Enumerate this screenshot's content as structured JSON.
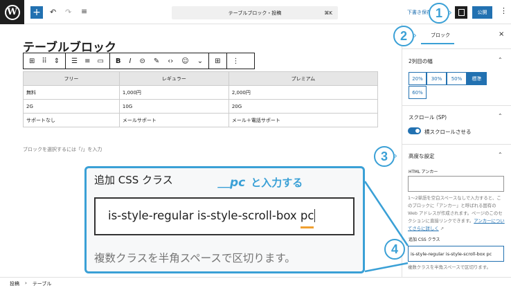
{
  "topbar": {
    "search": "テーブルブロック・投稿",
    "shortcut": "⌘K",
    "save_draft": "下書き保存",
    "publish": "公開"
  },
  "editor": {
    "title": "テーブルブロック",
    "placeholder": "ブロックを選択するには「/」を入力",
    "table": {
      "headers": [
        "フリー",
        "レギュラー",
        "プレミアム"
      ],
      "rows": [
        [
          "無料",
          "1,000円",
          "2,000円"
        ],
        [
          "2G",
          "10G",
          "20G"
        ],
        [
          "サポートなし",
          "メールサポート",
          "メール＋電話サポート"
        ]
      ]
    }
  },
  "sidebar": {
    "tab": "ブロック",
    "close": "×",
    "width_panel": {
      "title": "2列目の幅",
      "options": [
        "20%",
        "30%",
        "50%",
        "標準",
        "60%"
      ],
      "selected": "標準"
    },
    "scroll_panel": {
      "title": "スクロール (SP)",
      "toggle_label": "横スクロールさせる",
      "toggle_on": true
    },
    "advanced": {
      "title": "高度な設定",
      "anchor_label": "HTML アンカー",
      "anchor_value": "",
      "anchor_help": "1〜2単語を空白スペースなしで入力すると、このブロックに「アンカー」と呼ばれる固有の Web アドレスが作成されます。ページのこのセクションに直接リンクできます。",
      "anchor_link": "アンカーについてさらに詳しく",
      "css_label": "追加 CSS クラス",
      "css_value": "is-style-regular is-style-scroll-box pc",
      "css_help": "複数クラスを半角スペースで区切ります。"
    }
  },
  "breadcrumb": [
    "投稿",
    "テーブル"
  ],
  "callout": {
    "title": "追加 CSS クラス",
    "instruction_code": "＿pc",
    "instruction_text": "と入力する",
    "value_main": "is-style-regular is-style-scroll-box ",
    "value_highlight": "pc",
    "help": "複数クラスを半角スペースで区切ります。"
  },
  "markers": [
    "1",
    "2",
    "3",
    "4"
  ],
  "colors": {
    "accent": "#2271b1",
    "callout": "#3aa0d6",
    "highlight": "#f0a030"
  }
}
